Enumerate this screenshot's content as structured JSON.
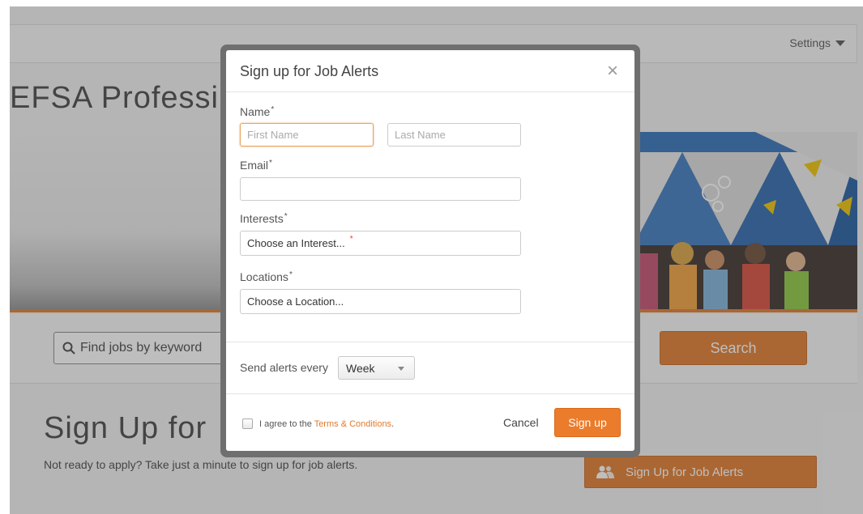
{
  "background": {
    "settings_label": "Settings",
    "page_title": "EFSA Professi",
    "search_placeholder": "Find jobs by keyword",
    "search_button": "Search",
    "signup_heading": "Sign Up for",
    "signup_subtitle": "Not ready to apply? Take just a minute to sign up for job alerts.",
    "alerts_button": "Sign Up for Job Alerts"
  },
  "modal": {
    "title": "Sign up for Job Alerts",
    "close_icon": "×",
    "name_label": "Name",
    "first_name_placeholder": "First Name",
    "last_name_placeholder": "Last Name",
    "email_label": "Email",
    "email_value": "",
    "interests_label": "Interests",
    "interests_value": "Choose an Interest...",
    "locations_label": "Locations",
    "locations_value": "Choose a Location...",
    "required_marker": "*",
    "frequency_label": "Send alerts every",
    "frequency_value": "Week",
    "agree_text": "I agree to the",
    "terms_link": "Terms & Conditions",
    "agree_suffix": ".",
    "agree_checked": false,
    "cancel_label": "Cancel",
    "submit_label": "Sign up"
  },
  "colors": {
    "accent": "#e07a2c",
    "focus_border": "#e9a35e",
    "overlay": "rgba(70,70,70,0.35)"
  }
}
